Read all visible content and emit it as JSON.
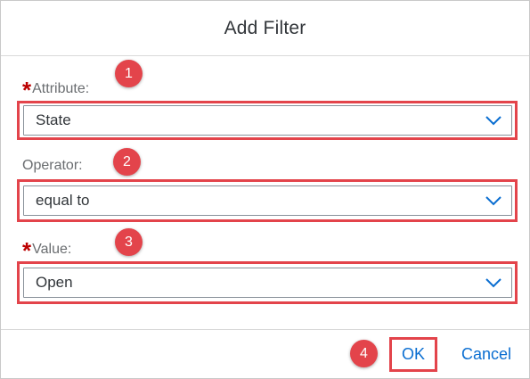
{
  "dialog": {
    "title": "Add Filter"
  },
  "fields": {
    "attribute": {
      "required_marker": "*",
      "label": "Attribute:",
      "value": "State",
      "badge": "1"
    },
    "operator": {
      "label": "Operator:",
      "value": "equal to",
      "badge": "2"
    },
    "value": {
      "required_marker": "*",
      "label": "Value:",
      "value": "Open",
      "badge": "3"
    }
  },
  "footer": {
    "ok_label": "OK",
    "cancel_label": "Cancel",
    "ok_badge": "4"
  },
  "colors": {
    "accent": "#0a6ed1",
    "highlight": "#e3444b",
    "required": "#bb0000"
  },
  "icons": {
    "dropdown": "chevron-down-icon"
  }
}
